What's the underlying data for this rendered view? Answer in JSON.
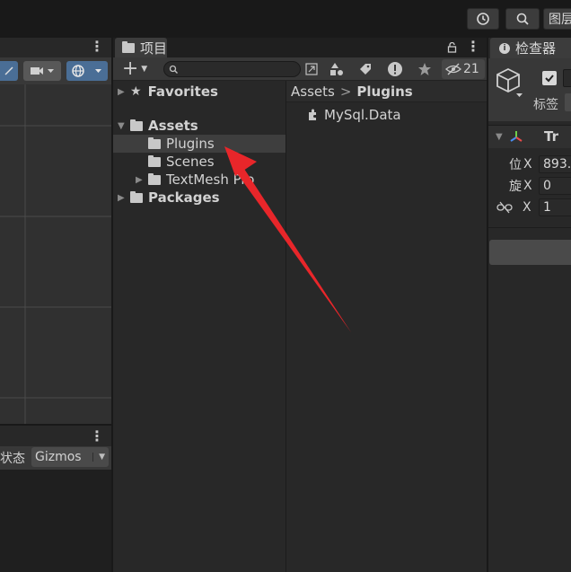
{
  "topbar": {
    "history_icon": "history-icon",
    "search_icon": "search-icon",
    "layers_label": "图层"
  },
  "scene": {
    "gizmos_label": "Gizmos",
    "status_label": "状态"
  },
  "project": {
    "tab_label": "项目",
    "hidden_count": "21",
    "breadcrumb_root": "Assets",
    "breadcrumb_separator": ">",
    "breadcrumb_current": "Plugins",
    "tree": {
      "favorites": "Favorites",
      "assets": "Assets",
      "plugins": "Plugins",
      "scenes": "Scenes",
      "textmesh": "TextMesh Pro",
      "packages": "Packages"
    },
    "files": [
      {
        "name": "MySql.Data"
      }
    ]
  },
  "inspector": {
    "tab_label": "检查器",
    "tag_label": "标签",
    "transform_label": "Tr",
    "position_label": "位",
    "rotation_label": "旋",
    "axis_x": "X",
    "position_x": "893.",
    "rotation_x": "0",
    "scale_x": "1"
  },
  "annotation": {
    "color": "#e8262a"
  }
}
